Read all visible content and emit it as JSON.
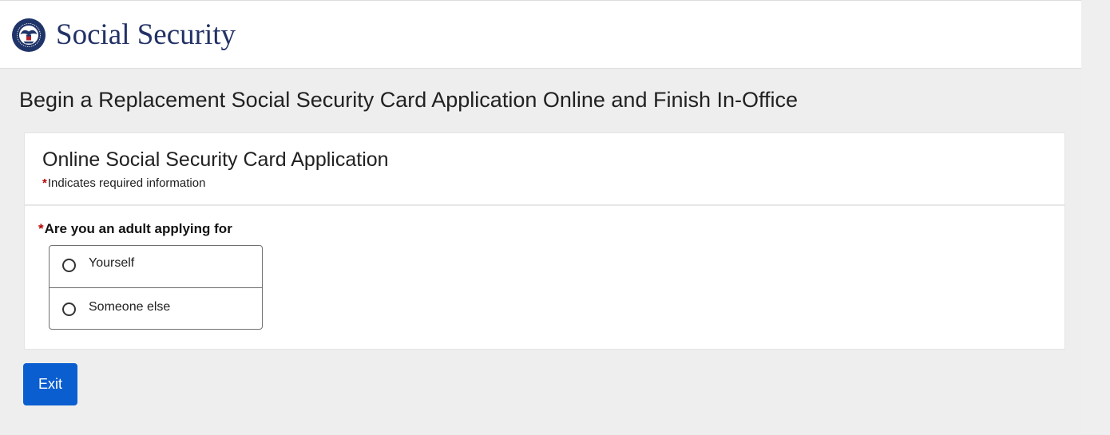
{
  "header": {
    "brand": "Social Security",
    "logo_icon": "ssa-seal-icon"
  },
  "page": {
    "title": "Begin a Replacement Social Security Card Application Online and Finish In-Office"
  },
  "card": {
    "title": "Online Social Security Card Application",
    "required_marker": "*",
    "required_note": "Indicates required information"
  },
  "form": {
    "question_marker": "*",
    "question": "Are you an adult applying for",
    "options": [
      {
        "label": "Yourself",
        "selected": false
      },
      {
        "label": "Someone else",
        "selected": false
      }
    ]
  },
  "actions": {
    "exit_label": "Exit"
  },
  "colors": {
    "brand_text": "#233266",
    "required_star": "#b70000",
    "primary_button": "#0b5ed0",
    "page_background": "#eeeeee"
  }
}
